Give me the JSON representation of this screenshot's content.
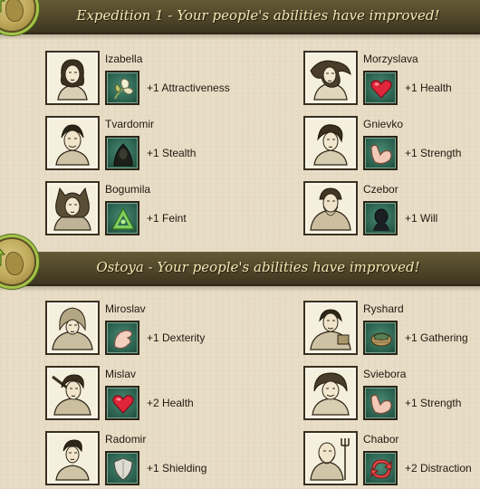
{
  "sections": [
    {
      "title": "Expedition 1 - Your people's abilities have improved!",
      "characters": [
        {
          "name": "Izabella",
          "ability": "+1 Attractiveness",
          "icon": "flower-icon"
        },
        {
          "name": "Morzyslava",
          "ability": "+1 Health",
          "icon": "heart-icon"
        },
        {
          "name": "Tvardomir",
          "ability": "+1 Stealth",
          "icon": "hooded-figure-icon"
        },
        {
          "name": "Gnievko",
          "ability": "+1 Strength",
          "icon": "flexed-arm-icon"
        },
        {
          "name": "Bogumila",
          "ability": "+1 Feint",
          "icon": "feint-triangle-icon"
        },
        {
          "name": "Czebor",
          "ability": "+1 Will",
          "icon": "head-silhouette-icon"
        }
      ]
    },
    {
      "title": "Ostoya - Your people's abilities have improved!",
      "characters": [
        {
          "name": "Miroslav",
          "ability": "+1 Dexterity",
          "icon": "hand-icon"
        },
        {
          "name": "Ryshard",
          "ability": "+1 Gathering",
          "icon": "basket-icon"
        },
        {
          "name": "Mislav",
          "ability": "+2 Health",
          "icon": "heart-icon"
        },
        {
          "name": "Sviebora",
          "ability": "+1 Strength",
          "icon": "flexed-arm-icon"
        },
        {
          "name": "Radomir",
          "ability": "+1 Shielding",
          "icon": "shield-icon"
        },
        {
          "name": "Chabor",
          "ability": "+2 Distraction",
          "icon": "distraction-arrows-icon"
        }
      ]
    }
  ],
  "colors": {
    "banner": "#544a2c",
    "banner_text": "#f3e7b4",
    "parchment": "#e8ddc6",
    "ability_icon_bg": "#2e6552",
    "medallion_ring": "#a5c44a"
  }
}
